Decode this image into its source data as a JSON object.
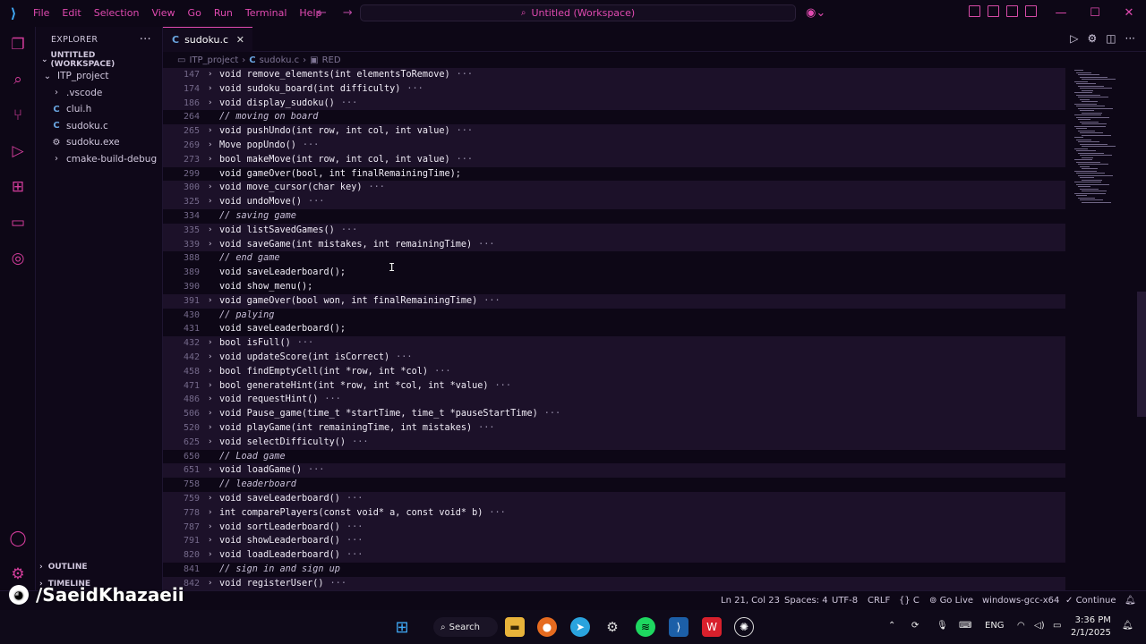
{
  "titlebar": {
    "menu": [
      "File",
      "Edit",
      "Selection",
      "View",
      "Go",
      "Run",
      "Terminal",
      "Help"
    ],
    "command_center": "Untitled (Workspace)"
  },
  "sidebar": {
    "header": "EXPLORER",
    "workspace": "UNTITLED (WORKSPACE)",
    "items": [
      {
        "label": "ITP_project",
        "icon": "folder-chevron-icon"
      },
      {
        "label": ".vscode",
        "icon": "chevron-right-icon"
      },
      {
        "label": "clui.h",
        "icon": "c-file-icon"
      },
      {
        "label": "sudoku.c",
        "icon": "c-file-icon"
      },
      {
        "label": "sudoku.exe",
        "icon": "exe-file-icon"
      },
      {
        "label": "cmake-build-debug",
        "icon": "chevron-right-icon"
      }
    ],
    "outline": "OUTLINE",
    "timeline": "TIMELINE"
  },
  "tab": {
    "label": "sudoku.c"
  },
  "breadcrumb": {
    "folder": "ITP_project",
    "file": "sudoku.c",
    "symbol": "RED"
  },
  "editor_lines": [
    {
      "num": "147",
      "text": "void remove_elements(int elementsToRemove)",
      "fold": true
    },
    {
      "num": "174",
      "text": "void sudoku_board(int difficulty)",
      "fold": true
    },
    {
      "num": "186",
      "text": "void display_sudoku()",
      "fold": true
    },
    {
      "num": "264",
      "text": "// moving on board",
      "comment": true
    },
    {
      "num": "265",
      "text": "void pushUndo(int row, int col, int value)",
      "fold": true
    },
    {
      "num": "269",
      "text": "Move popUndo()",
      "fold": true
    },
    {
      "num": "273",
      "text": "bool makeMove(int row, int col, int value)",
      "fold": true
    },
    {
      "num": "299",
      "text": "void gameOver(bool, int finalRemainingTime);"
    },
    {
      "num": "300",
      "text": "void move_cursor(char key)",
      "fold": true
    },
    {
      "num": "325",
      "text": "void undoMove()",
      "fold": true
    },
    {
      "num": "334",
      "text": "// saving game",
      "comment": true
    },
    {
      "num": "335",
      "text": "void listSavedGames()",
      "fold": true
    },
    {
      "num": "339",
      "text": "void saveGame(int mistakes, int remainingTime)",
      "fold": true
    },
    {
      "num": "388",
      "text": "// end game",
      "comment": true
    },
    {
      "num": "389",
      "text": "void saveLeaderboard();"
    },
    {
      "num": "390",
      "text": "void show_menu();"
    },
    {
      "num": "391",
      "text": "void gameOver(bool won, int finalRemainingTime)",
      "fold": true
    },
    {
      "num": "430",
      "text": "// palying",
      "comment": true
    },
    {
      "num": "431",
      "text": "void saveLeaderboard();"
    },
    {
      "num": "432",
      "text": "bool isFull()",
      "fold": true
    },
    {
      "num": "442",
      "text": "void updateScore(int isCorrect)",
      "fold": true
    },
    {
      "num": "458",
      "text": "bool findEmptyCell(int *row, int *col)",
      "fold": true
    },
    {
      "num": "471",
      "text": "bool generateHint(int *row, int *col, int *value)",
      "fold": true
    },
    {
      "num": "486",
      "text": "void requestHint()",
      "fold": true
    },
    {
      "num": "506",
      "text": "void Pause_game(time_t *startTime, time_t *pauseStartTime)",
      "fold": true
    },
    {
      "num": "520",
      "text": "void playGame(int remainingTime, int mistakes)",
      "fold": true
    },
    {
      "num": "625",
      "text": "void selectDifficulty()",
      "fold": true
    },
    {
      "num": "650",
      "text": "// Load game",
      "comment": true
    },
    {
      "num": "651",
      "text": "void loadGame()",
      "fold": true
    },
    {
      "num": "758",
      "text": "// leaderboard",
      "comment": true
    },
    {
      "num": "759",
      "text": "void saveLeaderboard()",
      "fold": true
    },
    {
      "num": "778",
      "text": "int comparePlayers(const void* a, const void* b)",
      "fold": true
    },
    {
      "num": "787",
      "text": "void sortLeaderboard()",
      "fold": true
    },
    {
      "num": "791",
      "text": "void showLeaderboard()",
      "fold": true
    },
    {
      "num": "820",
      "text": "void loadLeaderboard()",
      "fold": true
    },
    {
      "num": "841",
      "text": "// sign in and sign up",
      "comment": true
    },
    {
      "num": "842",
      "text": "void registerUser()",
      "fold": true
    }
  ],
  "statusbar": {
    "position": "Ln 21, Col 23",
    "spaces": "Spaces: 4",
    "encoding": "UTF-8",
    "eol": "CRLF",
    "language": "{} C",
    "golive": "Go Live",
    "compiler": "windows-gcc-x64",
    "continue": "Continue"
  },
  "taskbar": {
    "search": "Search",
    "lang": "ENG",
    "time": "3:36 PM",
    "date": "2/1/2025"
  },
  "watermark": "/SaeidKhazaeii",
  "colors": {
    "accent": "#e04ab0",
    "background": "#0d0716",
    "fold_highlight": "#1c1129"
  }
}
